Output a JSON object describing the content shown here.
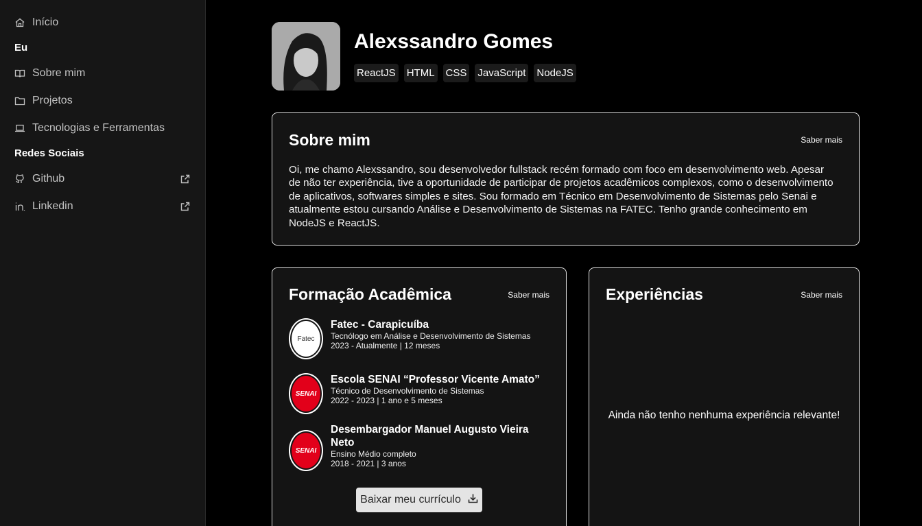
{
  "sidebar": {
    "home": {
      "label": "Início",
      "icon": "home-icon"
    },
    "section_me": "Eu",
    "about": {
      "label": "Sobre mim",
      "icon": "book-icon"
    },
    "projects": {
      "label": "Projetos",
      "icon": "folder-icon"
    },
    "tech": {
      "label": "Tecnologias e Ferramentas",
      "icon": "laptop-icon"
    },
    "section_social": "Redes Sociais",
    "github": {
      "label": "Github",
      "icon": "github-icon"
    },
    "linkedin": {
      "label": "Linkedin",
      "icon": "linkedin-icon"
    }
  },
  "profile": {
    "name": "Alexssandro Gomes",
    "tags": [
      "ReactJS",
      "HTML",
      "CSS",
      "JavaScript",
      "NodeJS"
    ]
  },
  "about": {
    "title": "Sobre mim",
    "link": "Saber mais",
    "text": "Oi, me chamo Alexssandro, sou desenvolvedor fullstack recém formado com foco em desenvolvimento web. Apesar de não ter experiência, tive a oportunidade de participar de projetos acadêmicos complexos, como o desenvolvimento de aplicativos, softwares simples e sites. Sou formado em Técnico em Desenvolvimento de Sistemas pelo Senai e atualmente estou cursando Análise e Desenvolvimento de Sistemas na FATEC. Tenho grande conhecimento em NodeJS e ReactJS."
  },
  "education": {
    "title": "Formação Acadêmica",
    "link": "Saber mais",
    "items": [
      {
        "name": "Fatec - Carapicuíba",
        "course": "Tecnólogo em Análise e Desenvolvimento de Sistemas",
        "period": "2023 - Atualmente | 12 meses",
        "logo_text": "Fatec"
      },
      {
        "name": "Escola SENAI “Professor Vicente Amato”",
        "course": "Técnico de Desenvolvimento de Sistemas",
        "period": "2022 - 2023 | 1 ano e 5 meses",
        "logo_text": "SENAI"
      },
      {
        "name": "Desembargador Manuel Augusto Vieira Neto",
        "course": "Ensino Médio completo",
        "period": "2018 - 2021 | 3 anos",
        "logo_text": "SENAI"
      }
    ],
    "cv_button": "Baixar meu currículo"
  },
  "experience": {
    "title": "Experiências",
    "link": "Saber mais",
    "empty_text": "Ainda não tenho nenhuma experiência relevante!"
  },
  "colors": {
    "background": "#000000",
    "sidebar": "#161616",
    "card_border": "#e0e0e0",
    "senai_red": "#e2001a"
  }
}
